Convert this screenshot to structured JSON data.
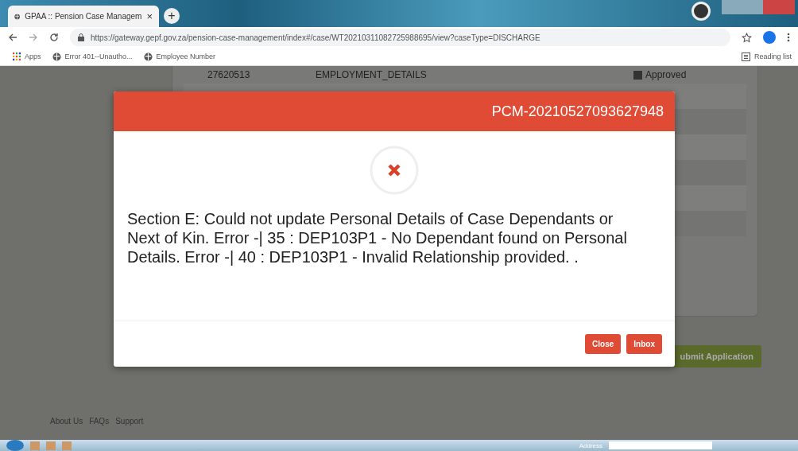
{
  "browser": {
    "tabs": [
      {
        "title": "GPAA :: Pension Case Managem",
        "close": "×",
        "selected": true
      }
    ],
    "new_tab": "+",
    "url": "https://gateway.gepf.gov.za/pension-case-management/index#/case/WT20210311082725988695/view?caseType=DISCHARGE",
    "bookmarks": [
      {
        "label": "Apps",
        "kind": "apps"
      },
      {
        "label": "Error 401--Unautho...",
        "kind": "site"
      },
      {
        "label": "Employee Number",
        "kind": "site"
      }
    ],
    "reading_list": "Reading list"
  },
  "page": {
    "rows": [
      {
        "id": "27620513",
        "section": "EMPLOYMENT_DETAILS",
        "status": "Approved",
        "checked": true
      }
    ],
    "submit_button": "ubmit Application",
    "footer_links": [
      "About Us",
      "FAQs",
      "Support"
    ]
  },
  "modal": {
    "title": "PCM-20210527093627948",
    "kind": "error",
    "message": "Section E: Could not update Personal Details of Case Dependants or Next of Kin. Error -| 35 : DEP103P1 - No Dependant found on Personal Details. Error -| 40 : DEP103P1 - Invalid Relationship provided. .",
    "buttons": [
      "Close",
      "Inbox"
    ]
  },
  "taskbar": {
    "address_label": "Address"
  }
}
